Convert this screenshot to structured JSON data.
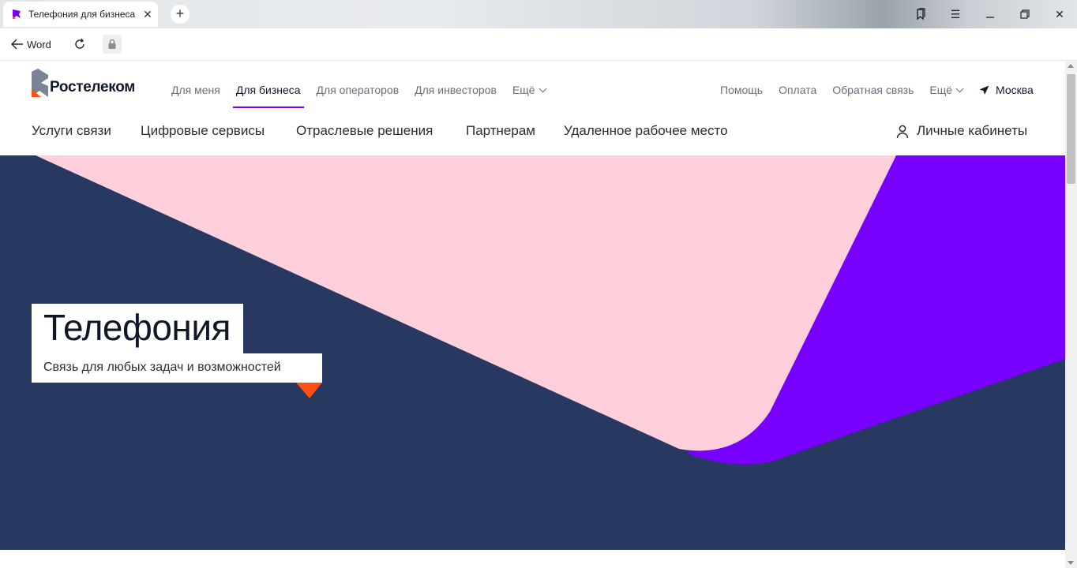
{
  "browser": {
    "tab_title": "Телефония для бизнеса",
    "back_label": "Word",
    "icons": [
      "favicon-icon",
      "close-icon",
      "plus-icon",
      "bookmarks-icon",
      "menu-icon",
      "minimize-icon",
      "restore-icon",
      "close-window-icon",
      "back-arrow-icon",
      "reload-icon",
      "lock-icon"
    ]
  },
  "header": {
    "logo_text": "Ростелеком",
    "nav": [
      "Для меня",
      "Для бизнеса",
      "Для операторов",
      "Для инвесторов",
      "Ещё"
    ],
    "active_nav": "Для бизнеса",
    "right_nav": [
      "Помощь",
      "Оплата",
      "Обратная связь",
      "Ещё"
    ],
    "city": "Москва"
  },
  "subnav": {
    "items": [
      "Услуги связи",
      "Цифровые сервисы",
      "Отраслевые решения",
      "Партнерам",
      "Удаленное рабочее место"
    ],
    "cabinet": "Личные кабинеты"
  },
  "hero": {
    "title": "Телефония",
    "subtitle": "Связь для любых задач и возможностей"
  },
  "colors": {
    "accent": "#7700ff",
    "brand_orange": "#ff4f12",
    "hero_dark": "#283961",
    "hero_pink": "#ffd0dc",
    "hero_purple": "#7700ff"
  }
}
